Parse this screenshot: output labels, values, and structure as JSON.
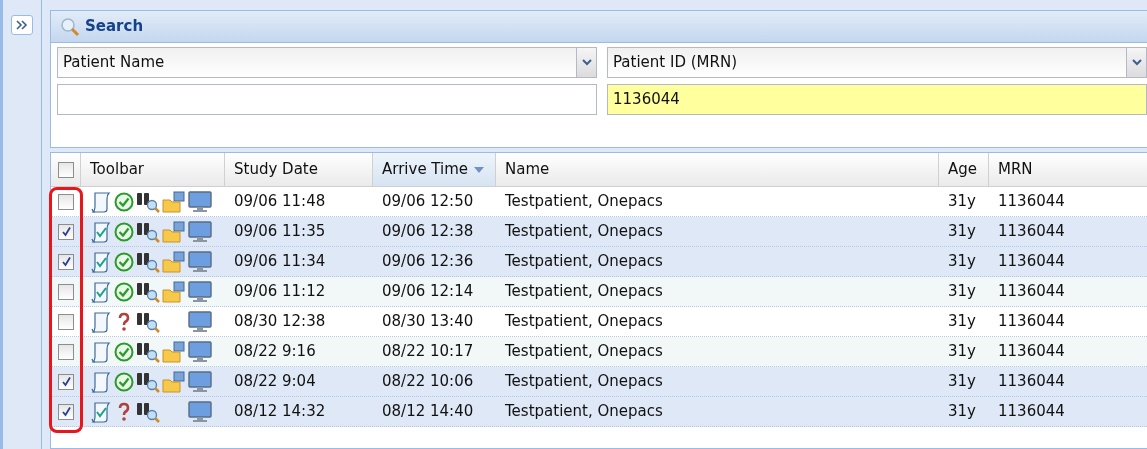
{
  "search": {
    "title": "Search",
    "fields": [
      {
        "criterion": "Patient Name",
        "highlighted": false
      },
      {
        "criterion": "Patient ID (MRN)",
        "value": "1136044",
        "highlighted": true
      }
    ]
  },
  "grid": {
    "columns": [
      {
        "label": "Toolbar",
        "sorted": false
      },
      {
        "label": "Study Date",
        "sorted": false
      },
      {
        "label": "Arrive Time",
        "sorted": true
      },
      {
        "label": "Name",
        "sorted": false
      },
      {
        "label": "Age",
        "sorted": false
      },
      {
        "label": "MRN",
        "sorted": false
      }
    ],
    "all_checked": false,
    "rows": [
      {
        "checked": false,
        "report_signed": false,
        "completed": true,
        "folder": true,
        "study_date": "09/06 11:48",
        "arrive_time": "09/06 12:50",
        "name": "Testpatient, Onepacs",
        "age": "31y",
        "mrn": "1136044"
      },
      {
        "checked": true,
        "report_signed": true,
        "completed": true,
        "folder": true,
        "study_date": "09/06 11:35",
        "arrive_time": "09/06 12:38",
        "name": "Testpatient, Onepacs",
        "age": "31y",
        "mrn": "1136044"
      },
      {
        "checked": true,
        "report_signed": true,
        "completed": true,
        "folder": true,
        "study_date": "09/06 11:34",
        "arrive_time": "09/06 12:36",
        "name": "Testpatient, Onepacs",
        "age": "31y",
        "mrn": "1136044"
      },
      {
        "checked": false,
        "report_signed": true,
        "completed": true,
        "folder": true,
        "study_date": "09/06 11:12",
        "arrive_time": "09/06 12:14",
        "name": "Testpatient, Onepacs",
        "age": "31y",
        "mrn": "1136044"
      },
      {
        "checked": false,
        "report_signed": false,
        "completed": false,
        "folder": false,
        "study_date": "08/30 12:38",
        "arrive_time": "08/30 13:40",
        "name": "Testpatient, Onepacs",
        "age": "31y",
        "mrn": "1136044"
      },
      {
        "checked": false,
        "report_signed": false,
        "completed": true,
        "folder": true,
        "study_date": "08/22 9:16",
        "arrive_time": "08/22 10:17",
        "name": "Testpatient, Onepacs",
        "age": "31y",
        "mrn": "1136044"
      },
      {
        "checked": true,
        "report_signed": false,
        "completed": true,
        "folder": true,
        "study_date": "08/22 9:04",
        "arrive_time": "08/22 10:06",
        "name": "Testpatient, Onepacs",
        "age": "31y",
        "mrn": "1136044"
      },
      {
        "checked": true,
        "report_signed": true,
        "completed": false,
        "folder": false,
        "study_date": "08/12 14:32",
        "arrive_time": "08/12 14:40",
        "name": "Testpatient, Onepacs",
        "age": "31y",
        "mrn": "1136044"
      }
    ]
  }
}
